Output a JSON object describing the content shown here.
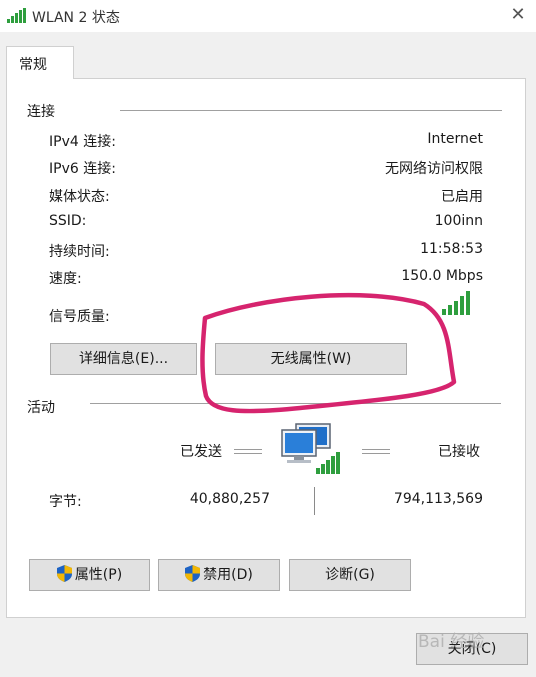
{
  "window": {
    "title": "WLAN 2 状态",
    "close_glyph": "✕"
  },
  "tabs": [
    {
      "label": "常规"
    }
  ],
  "connection": {
    "section_title": "连接",
    "rows": [
      {
        "label": "IPv4 连接:",
        "value": "Internet"
      },
      {
        "label": "IPv6 连接:",
        "value": "无网络访问权限"
      },
      {
        "label": "媒体状态:",
        "value": "已启用"
      },
      {
        "label": "SSID:",
        "value": "100inn"
      },
      {
        "label": "持续时间:",
        "value": "11:58:53"
      },
      {
        "label": "速度:",
        "value": "150.0 Mbps"
      }
    ],
    "signal_label": "信号质量:",
    "signal_bars_filled": 5,
    "signal_bars_total": 5
  },
  "buttons": {
    "details": "详细信息(E)...",
    "wireless_props": "无线属性(W)",
    "properties": "属性(P)",
    "disable": "禁用(D)",
    "diagnose": "诊断(G)",
    "close": "关闭(C)"
  },
  "activity": {
    "section_title": "活动",
    "sent_label": "已发送",
    "received_label": "已接收",
    "bytes_label": "字节:",
    "bytes_sent": "40,880,257",
    "bytes_received": "794,113,569"
  },
  "watermark": "Bai 经验",
  "colors": {
    "annotation": "#d6246e",
    "signal_green": "#2e9e3e",
    "shield_blue": "#1d63c4",
    "shield_yellow": "#f2b705"
  },
  "icons": {
    "title": "wifi-signal-icon",
    "network": "network-computers-icon",
    "shield": "uac-shield-icon"
  }
}
